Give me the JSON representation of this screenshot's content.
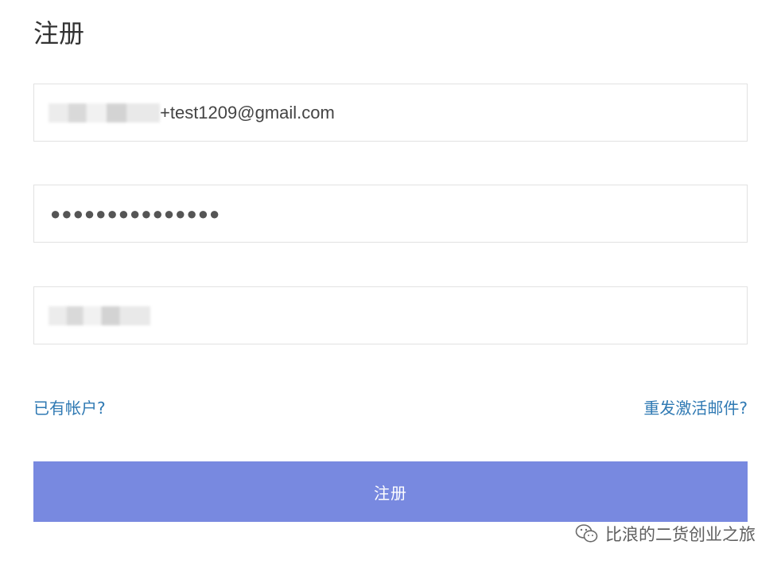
{
  "page": {
    "title": "注册"
  },
  "form": {
    "email": {
      "value": "+test1209@gmail.com"
    },
    "password": {
      "value": "●●●●●●●●●●●●●●●"
    },
    "username": {
      "value": ""
    }
  },
  "links": {
    "have_account": "已有帐户?",
    "resend_activation": "重发激活邮件?"
  },
  "submit": {
    "label": "注册"
  },
  "watermark": {
    "text": "比浪的二货创业之旅",
    "icon": "wechat-icon"
  },
  "colors": {
    "submit_bg": "#7889e0",
    "link": "#2f79b3",
    "border": "#e2e2e2"
  }
}
